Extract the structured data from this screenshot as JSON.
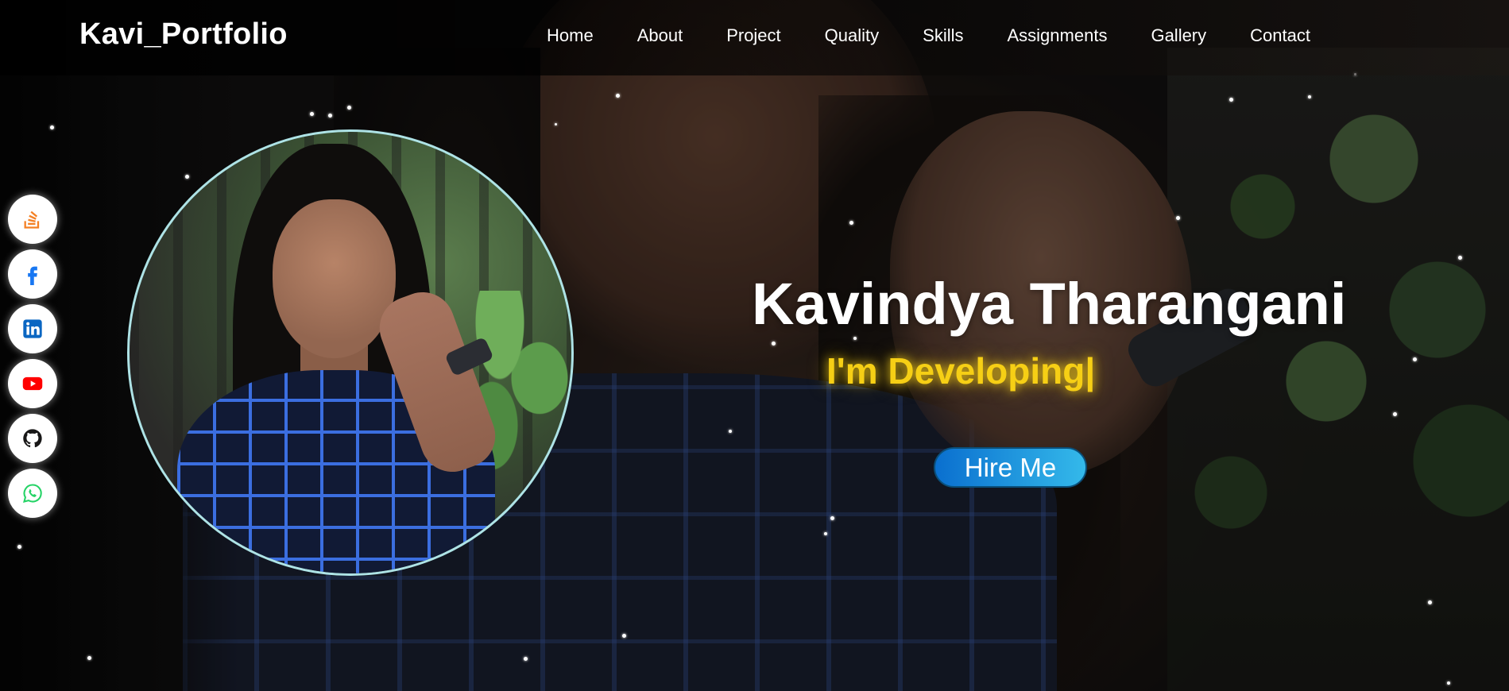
{
  "header": {
    "logo": "Kavi_Portfolio",
    "nav": [
      {
        "label": "Home"
      },
      {
        "label": "About"
      },
      {
        "label": "Project"
      },
      {
        "label": "Quality"
      },
      {
        "label": "Skills"
      },
      {
        "label": "Assignments"
      },
      {
        "label": "Gallery"
      },
      {
        "label": "Contact"
      }
    ]
  },
  "social": [
    {
      "icon": "stackoverflow-icon",
      "color": "#f48024"
    },
    {
      "icon": "facebook-icon",
      "color": "#1877f2"
    },
    {
      "icon": "linkedin-icon",
      "color": "#0a66c2"
    },
    {
      "icon": "youtube-icon",
      "color": "#ff0000"
    },
    {
      "icon": "github-icon",
      "color": "#181717"
    },
    {
      "icon": "whatsapp-icon",
      "color": "#25d366"
    }
  ],
  "hero": {
    "name": "Kavindya Tharangani",
    "typing_text": "I'm Developing|",
    "hire_button": "Hire Me"
  },
  "colors": {
    "accent_yellow": "#f6cf15",
    "button_gradient_start": "#0a6fcf",
    "button_gradient_end": "#34b9ea",
    "profile_border": "#aee3e6"
  }
}
